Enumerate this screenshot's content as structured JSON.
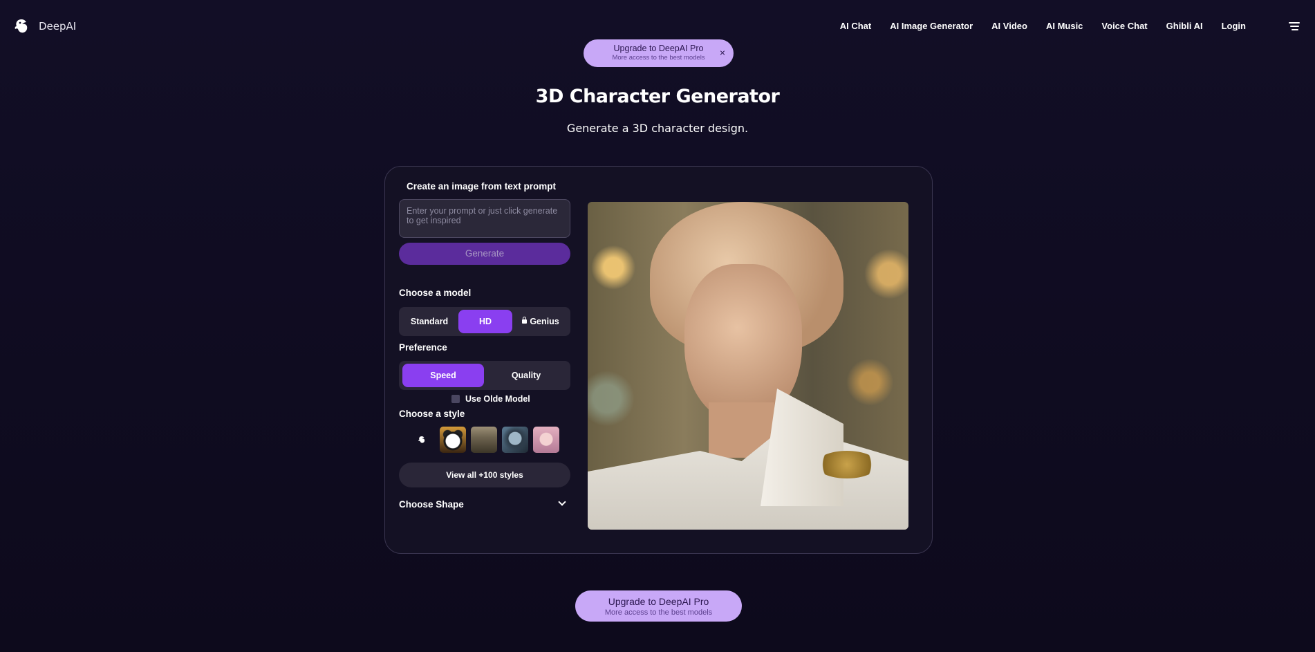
{
  "nav": {
    "brand": "DeepAI",
    "links": [
      "AI Chat",
      "AI Image Generator",
      "AI Video",
      "AI Music",
      "Voice Chat",
      "Ghibli AI",
      "Login"
    ]
  },
  "upgrade_banner": {
    "title": "Upgrade to DeepAI Pro",
    "subtitle": "More access to the best models",
    "close": "×"
  },
  "page": {
    "title": "3D Character Generator",
    "subtitle": "Generate a 3D character design."
  },
  "form": {
    "create_title": "Create an image from text prompt",
    "prompt_placeholder": "Enter your prompt or just click generate to get inspired",
    "generate_label": "Generate",
    "model_title": "Choose a model",
    "models": [
      "Standard",
      "HD",
      "Genius"
    ],
    "model_selected": "HD",
    "preference_title": "Preference",
    "preferences": [
      "Speed",
      "Quality"
    ],
    "preference_selected": "Speed",
    "olde_label": "Use Olde Model",
    "olde_checked": false,
    "style_title": "Choose a style",
    "styles": [
      "none-icon",
      "panda-style",
      "forest-style",
      "robot-style",
      "girl-style"
    ],
    "view_all_label": "View all +100 styles",
    "shape_label": "Choose Shape"
  },
  "bottom_upgrade": {
    "title": "Upgrade to DeepAI Pro",
    "subtitle": "More access to the best models"
  },
  "colors": {
    "background": "#120e26",
    "accent": "#8a3ff0",
    "upgrade_pill": "#c8a8f7",
    "generate": "#5b2c9c"
  }
}
